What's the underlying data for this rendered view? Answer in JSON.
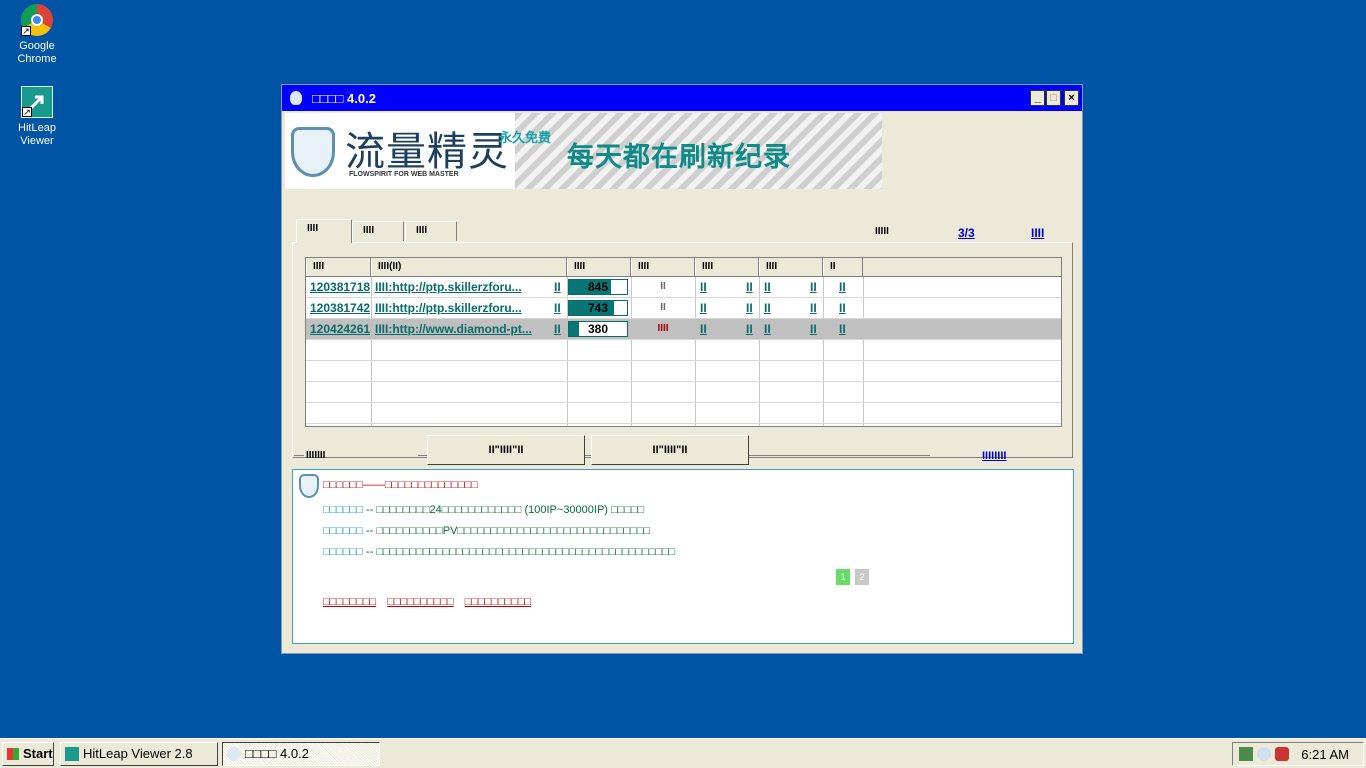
{
  "desktop": {
    "icons": [
      {
        "label_line1": "Google",
        "label_line2": "Chrome"
      },
      {
        "label_line1": "HitLeap Viewer",
        "label_line2": ""
      }
    ]
  },
  "window": {
    "title": "□□□□ 4.0.2",
    "controls": {
      "minimize": "_",
      "maximize": "□",
      "close": "×"
    }
  },
  "banner": {
    "logo_text": "流量精灵",
    "logo_sub": "FLOWSPIRIT FOR WEB MASTER",
    "free_tag": "永久免费",
    "slogan": "每天都在刷新纪录"
  },
  "tabs": [
    "IIII",
    "IIII",
    "IIII"
  ],
  "top_links": {
    "label": "IIIII",
    "page": "3/3",
    "more": "IIII"
  },
  "table": {
    "headers": [
      "IIII",
      "IIII(II)",
      "IIII",
      "IIII",
      "IIII",
      "IIII",
      "II"
    ],
    "rows": [
      {
        "id": "120381718",
        "url": "IIII:http://ptp.skillerzforu...",
        "mark": "II",
        "progress_value": "845",
        "progress_fraction": 0.73,
        "status": "II",
        "c1a": "II",
        "c1b": "II",
        "c2a": "II",
        "c2b": "II",
        "c3": "II",
        "selected": false,
        "status_red": false
      },
      {
        "id": "120381742",
        "url": "IIII:http://ptp.skillerzforu...",
        "mark": "II",
        "progress_value": "743",
        "progress_fraction": 0.78,
        "status": "II",
        "c1a": "II",
        "c1b": "II",
        "c2a": "II",
        "c2b": "II",
        "c3": "II",
        "selected": false,
        "status_red": false
      },
      {
        "id": "120424261",
        "url": "IIII:http://www.diamond-pt...",
        "mark": "II",
        "progress_value": "380",
        "progress_fraction": 0.18,
        "status": "IIII",
        "c1a": "II",
        "c1b": "II",
        "c2a": "II",
        "c2b": "II",
        "c3": "II",
        "selected": true,
        "status_red": true
      }
    ]
  },
  "bottom": {
    "label": "IIIIIII",
    "button1": "II\"IIII\"II",
    "button2": "II\"IIII\"II",
    "link": "IIIIIIII"
  },
  "info": {
    "headline": "□□□□□□——□□□□□□□□□□□□□□",
    "lines": [
      {
        "k": "□□□□□□",
        "v": " -- □□□□□□□□24□□□□□□□□□□□□ (100IP~30000IP) □□□□□"
      },
      {
        "k": "□□□□□□",
        "v": " -- □□□□□□□□□□PV□□□□□□□□□□□□□□□□□□□□□□□□□□□□□"
      },
      {
        "k": "□□□□□□",
        "v": " -- □□□□□□□□□□□□□□□□□□□□□□□□□□□□□□□□□□□□□□□□□□□□□"
      }
    ],
    "pager": [
      "1",
      "2"
    ],
    "red_links": [
      "□□□□□□□□",
      "□□□□□□□□□□",
      "□□□□□□□□□□"
    ]
  },
  "taskbar": {
    "start": "Start",
    "items": [
      "HitLeap Viewer 2.8",
      "□□□□ 4.0.2"
    ],
    "clock": "6:21 AM"
  },
  "colors": {
    "desktop": "#0054a6",
    "titlebar": "#0000ff",
    "accent": "#0a6b6b",
    "alert": "#c00000"
  }
}
